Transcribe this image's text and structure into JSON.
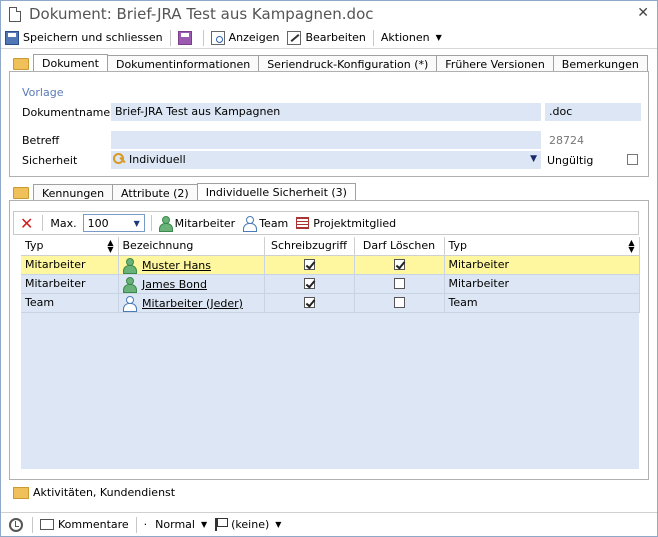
{
  "window": {
    "title": "Dokument: Brief-JRA Test aus Kampagnen.doc",
    "close_glyph": "✕"
  },
  "toolbar": {
    "save_close": "Speichern und schliessen",
    "view": "Anzeigen",
    "edit": "Bearbeiten",
    "actions": "Aktionen"
  },
  "tabs_top": [
    "Dokument",
    "Dokumentinformationen",
    "Seriendruck-Konfiguration (*)",
    "Frühere Versionen",
    "Bemerkungen"
  ],
  "document": {
    "section": "Vorlage",
    "name_label": "Dokumentname",
    "name_value": "Brief-JRA Test aus Kampagnen",
    "extension": ".doc",
    "subject_label": "Betreff",
    "subject_value": "",
    "id_value": "28724",
    "security_label": "Sicherheit",
    "security_value": "Individuell",
    "invalid_label": "Ungültig"
  },
  "tabs_bottom": [
    "Kennungen",
    "Attribute (2)",
    "Individuelle Sicherheit (3)"
  ],
  "grid_toolbar": {
    "max_label": "Max.",
    "max_value": "100",
    "employee": "Mitarbeiter",
    "team": "Team",
    "project_member": "Projektmitglied"
  },
  "table": {
    "headers": [
      "Typ",
      "Bezeichnung",
      "Schreibzugriff",
      "Darf Löschen",
      "Typ"
    ],
    "rows": [
      {
        "typ": "Mitarbeiter",
        "name": "Muster Hans",
        "write": true,
        "delete": true,
        "typ2": "Mitarbeiter",
        "icon": "person-icon"
      },
      {
        "typ": "Mitarbeiter",
        "name": "James Bond",
        "write": true,
        "delete": false,
        "typ2": "Mitarbeiter",
        "icon": "person-icon"
      },
      {
        "typ": "Team",
        "name": "Mitarbeiter (Jeder)",
        "write": true,
        "delete": false,
        "typ2": "Team",
        "icon": "team-icon"
      }
    ]
  },
  "footer_section": "Aktivitäten, Kundendienst",
  "status": {
    "comments": "Kommentare",
    "priority": "Normal",
    "flag": "(keine)"
  }
}
